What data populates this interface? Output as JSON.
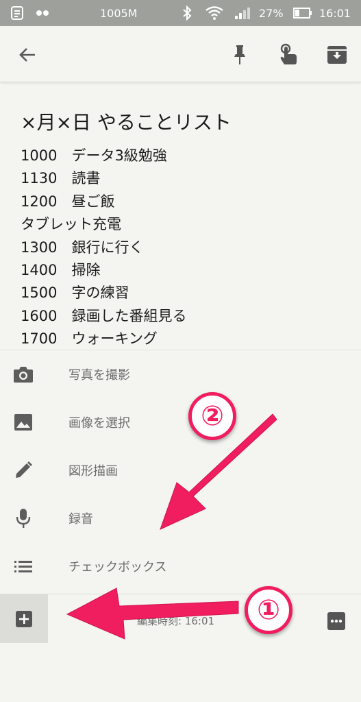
{
  "status_bar": {
    "network_speed": "1005M",
    "battery_percent": "27%",
    "time": "16:01"
  },
  "note": {
    "title": "×月×日 やることリスト",
    "lines": [
      "1000　データ3級勉強",
      "1130　読書",
      "1200　昼ご飯",
      "タブレット充電",
      "1300　銀行に行く",
      "1400　掃除",
      "1500　字の練習",
      "1600　録画した番組見る",
      "1700　ウォーキング"
    ]
  },
  "add_menu": {
    "items": [
      {
        "label": "写真を撮影",
        "icon": "camera-icon"
      },
      {
        "label": "画像を選択",
        "icon": "image-icon"
      },
      {
        "label": "図形描画",
        "icon": "pen-icon"
      },
      {
        "label": "録音",
        "icon": "mic-icon"
      },
      {
        "label": "チェックボックス",
        "icon": "list-icon"
      }
    ]
  },
  "bottom_bar": {
    "edited_text": "編集時刻: 16:01"
  },
  "annotations": {
    "marker_1": "①",
    "marker_2": "②",
    "color": "#f01d5f"
  }
}
